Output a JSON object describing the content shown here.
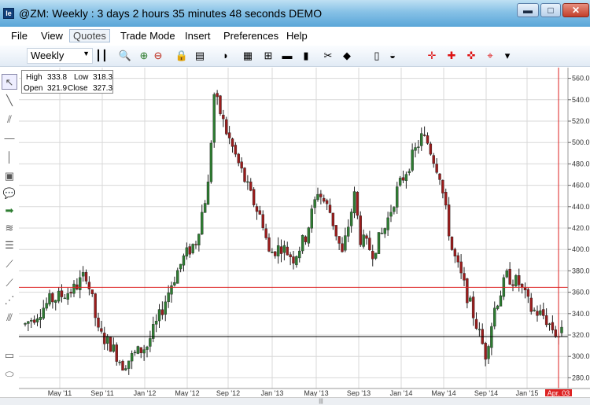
{
  "window": {
    "app_icon_label": "le",
    "title": "@ZM: Weekly : 3 days 2 hours 35 minutes 48 seconds DEMO",
    "minimize_glyph": "▬",
    "maximize_glyph": "□",
    "close_glyph": "✕"
  },
  "menu": {
    "items": [
      "File",
      "View",
      "Quotes",
      "Trade Mode",
      "Insert",
      "Preferences",
      "Help"
    ]
  },
  "toolbar": {
    "period": "Weekly",
    "period_arrow": "▼",
    "tools": [
      {
        "name": "bars-style-icon",
        "glyph": "┃┃"
      },
      {
        "name": "zoom-search-icon",
        "glyph": "🔍"
      },
      {
        "name": "zoom-in-icon",
        "glyph": "⊕"
      },
      {
        "name": "zoom-out-icon",
        "glyph": "⊖"
      },
      {
        "name": "lock-icon",
        "glyph": "🔒"
      },
      {
        "name": "page-icon",
        "glyph": "▤"
      },
      {
        "name": "cursor-3d-icon",
        "glyph": "◗"
      },
      {
        "name": "chart-add-icon",
        "glyph": "▦"
      },
      {
        "name": "hierarchy-icon",
        "glyph": "⊞"
      },
      {
        "name": "colors-icon",
        "glyph": "▬"
      },
      {
        "name": "bars-icon",
        "glyph": "▮"
      },
      {
        "name": "scissors-icon",
        "glyph": "✂"
      },
      {
        "name": "paint-icon",
        "glyph": "◆"
      },
      {
        "name": "phone-icon",
        "glyph": "▯"
      },
      {
        "name": "mouse-icon",
        "glyph": "◒"
      },
      {
        "name": "crosshair-box-icon",
        "glyph": "✛"
      },
      {
        "name": "crosshair-icon",
        "glyph": "✚"
      },
      {
        "name": "crosshair-dot-icon",
        "glyph": "✜"
      },
      {
        "name": "crosshair-split-icon",
        "glyph": "⌖"
      },
      {
        "name": "more-icon",
        "glyph": "▾"
      }
    ]
  },
  "sidebar": {
    "tools": [
      {
        "name": "pointer-icon",
        "glyph": "↖"
      },
      {
        "name": "line-icon",
        "glyph": "╲"
      },
      {
        "name": "parallel-lines-icon",
        "glyph": "⫽"
      },
      {
        "name": "horizontal-line-icon",
        "glyph": "—"
      },
      {
        "name": "vertical-line-icon",
        "glyph": "│"
      },
      {
        "name": "note-icon",
        "glyph": "▣"
      },
      {
        "name": "callout-icon",
        "glyph": "💬"
      },
      {
        "name": "arrow-icon",
        "glyph": "➡"
      },
      {
        "name": "wave-icon",
        "glyph": "≋"
      },
      {
        "name": "fib-icon",
        "glyph": "☰"
      },
      {
        "name": "gann-fan-icon",
        "glyph": "⟋"
      },
      {
        "name": "andrews-icon",
        "glyph": "⟋"
      },
      {
        "name": "pitchfork-icon",
        "glyph": "⋰"
      },
      {
        "name": "speed-lines-icon",
        "glyph": "⫻"
      },
      {
        "name": "rectangle-icon",
        "glyph": "▭"
      },
      {
        "name": "ellipse-icon",
        "glyph": "⬭"
      }
    ]
  },
  "ohlc": {
    "high_label": "High",
    "high": "333.8",
    "low_label": "Low",
    "low": "318.3",
    "open_label": "Open",
    "open": "321.9",
    "close_label": "Close",
    "close": "327.3"
  },
  "scrollbar": {
    "thumb_glyph": "|||"
  },
  "colors": {
    "up": "#2e7d32",
    "down": "#9b1c1c",
    "grid": "#d8d8d8",
    "red_line": "#d22",
    "black_line": "#000"
  },
  "chart_data": {
    "type": "candlestick",
    "symbol": "@ZM",
    "period": "Weekly",
    "y_ticks": [
      280,
      300,
      320,
      340,
      360,
      380,
      400,
      420,
      440,
      460,
      480,
      500,
      520,
      540,
      560
    ],
    "ylim": [
      270,
      570
    ],
    "x_labels": [
      "May '11",
      "Sep '11",
      "Jan '12",
      "May '12",
      "Sep '12",
      "Jan '13",
      "May '13",
      "Sep '13",
      "Jan '14",
      "May '14",
      "Sep '14",
      "Jan '15",
      "Apr. 03"
    ],
    "price_lines": [
      {
        "value": 364.6,
        "label": "364.6",
        "color": "red"
      },
      {
        "value": 318.5,
        "label": "318.5",
        "color": "black"
      }
    ],
    "current_marker_label": "Apr. 03",
    "close_path": [
      [
        0,
        330
      ],
      [
        4,
        340
      ],
      [
        8,
        352
      ],
      [
        12,
        357
      ],
      [
        16,
        363
      ],
      [
        20,
        377
      ],
      [
        22,
        352
      ],
      [
        24,
        322
      ],
      [
        28,
        311
      ],
      [
        32,
        292
      ],
      [
        36,
        302
      ],
      [
        40,
        310
      ],
      [
        44,
        337
      ],
      [
        48,
        368
      ],
      [
        52,
        392
      ],
      [
        56,
        408
      ],
      [
        60,
        460
      ],
      [
        62,
        545
      ],
      [
        64,
        528
      ],
      [
        66,
        510
      ],
      [
        70,
        480
      ],
      [
        74,
        450
      ],
      [
        78,
        425
      ],
      [
        80,
        396
      ],
      [
        84,
        403
      ],
      [
        88,
        392
      ],
      [
        92,
        412
      ],
      [
        96,
        455
      ],
      [
        100,
        435
      ],
      [
        104,
        395
      ],
      [
        108,
        450
      ],
      [
        110,
        410
      ],
      [
        114,
        398
      ],
      [
        118,
        420
      ],
      [
        122,
        455
      ],
      [
        126,
        480
      ],
      [
        130,
        505
      ],
      [
        132,
        500
      ],
      [
        136,
        470
      ],
      [
        140,
        400
      ],
      [
        144,
        366
      ],
      [
        148,
        330
      ],
      [
        151,
        302
      ],
      [
        154,
        345
      ],
      [
        158,
        375
      ],
      [
        162,
        368
      ],
      [
        166,
        344
      ],
      [
        170,
        338
      ],
      [
        174,
        322
      ],
      [
        176,
        318
      ]
    ],
    "last_candle": {
      "open": 321.9,
      "high": 333.8,
      "low": 318.3,
      "close": 327.3
    }
  }
}
